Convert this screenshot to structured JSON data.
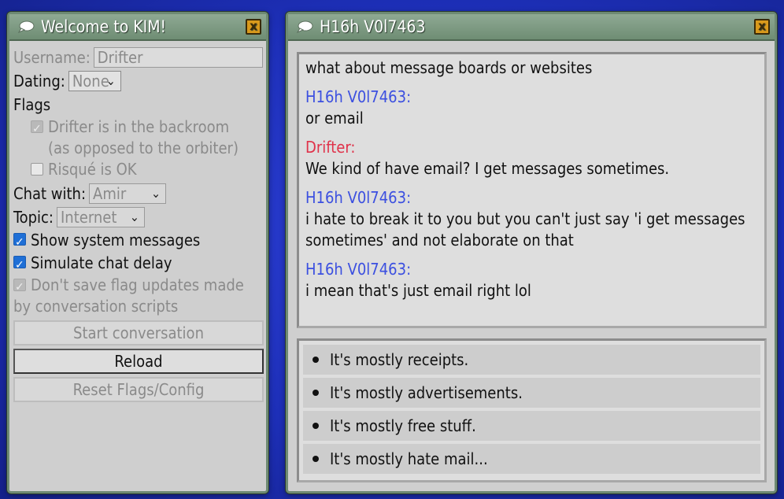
{
  "left_window": {
    "title": "Welcome to KIM!",
    "close": "x",
    "username_label": "Username:",
    "username_value": "Drifter",
    "dating_label": "Dating:",
    "dating_value": "None",
    "flags_heading": "Flags",
    "flag_backroom": "Drifter is in the backroom (as opposed to the orbiter)",
    "flag_risque": "Risqué is OK",
    "chat_with_label": "Chat with:",
    "chat_with_value": "Amir",
    "topic_label": "Topic:",
    "topic_value": "Internet",
    "opt_system_messages": "Show system messages",
    "opt_chat_delay": "Simulate chat delay",
    "opt_dont_save": "Don't save flag updates made by conversation scripts",
    "btn_start": "Start conversation",
    "btn_reload": "Reload",
    "btn_reset": "Reset Flags/Config"
  },
  "right_window": {
    "title": "H16h V0l7463",
    "close": "x",
    "messages": [
      {
        "sender": "",
        "text": "what about message boards or websites"
      },
      {
        "sender": "H16h V0l7463:",
        "text": "or email"
      },
      {
        "sender": "Drifter:",
        "text": "We kind of have email? I get messages sometimes."
      },
      {
        "sender": "H16h V0l7463:",
        "text": "i hate to break it to you but you can't just say 'i get messages sometimes' and not elaborate on that"
      },
      {
        "sender": "H16h V0l7463:",
        "text": "i mean that's just email right lol"
      }
    ],
    "choices": [
      "It's mostly receipts.",
      "It's mostly advertisements.",
      "It's mostly free stuff.",
      "It's mostly hate mail..."
    ]
  },
  "colors": {
    "bot_sender": "#3b4fe0",
    "user_sender": "#e0324a",
    "titlebar": "#7f9b84",
    "desktop": "#1d2fb8"
  }
}
